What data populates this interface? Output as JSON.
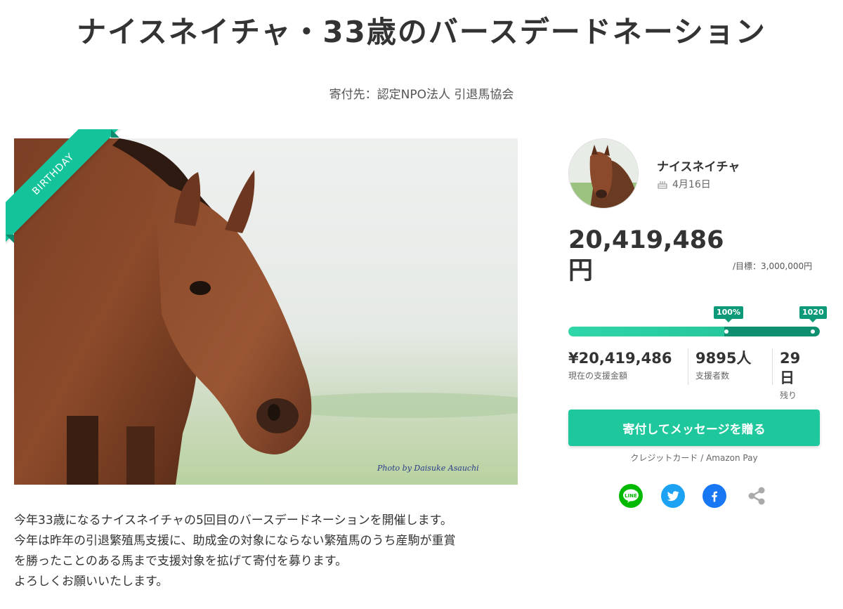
{
  "page": {
    "title": "ナイスネイチャ・33歳のバースデードネーション",
    "recipient": "寄付先：認定NPO法人 引退馬協会"
  },
  "hero": {
    "ribbon_label": "BIRTHDAY",
    "photo_credit": "Photo by Daisuke Asauchi"
  },
  "profile": {
    "name": "ナイスネイチャ",
    "birthday": "4月16日",
    "birthday_icon": "cake-icon"
  },
  "funding": {
    "raised": "20,419,486円",
    "goal": "/目標：3,000,000円",
    "progress_percent": 680,
    "badge_100": "100%",
    "badge_current": "1020"
  },
  "stats": [
    {
      "value": "¥20,419,486",
      "label": "現在の支援金額"
    },
    {
      "value": "9895人",
      "label": "支援者数"
    },
    {
      "value": "29日",
      "label": "残り"
    }
  ],
  "cta": {
    "donate_label": "寄付してメッセージを贈る",
    "payment_methods": "クレジットカード / Amazon Pay"
  },
  "share": {
    "line_label": "LINE",
    "icons": [
      "line-icon",
      "twitter-icon",
      "facebook-icon",
      "share-icon"
    ]
  },
  "description": [
    "今年33歳になるナイスネイチャの5回目のバースデードネーションを開催します。",
    "今年は昨年の引退繁殖馬支援に、助成金の対象にならない繁殖馬のうち産駒が重賞",
    "を勝ったことのある馬まで支援対象を拡げて寄付を募ります。",
    "よろしくお願いいたします。"
  ],
  "colors": {
    "accent": "#1fc79c",
    "accent_dark": "#0e9a78",
    "line": "#00b900",
    "twitter": "#1da1f2",
    "facebook": "#1877f2"
  }
}
